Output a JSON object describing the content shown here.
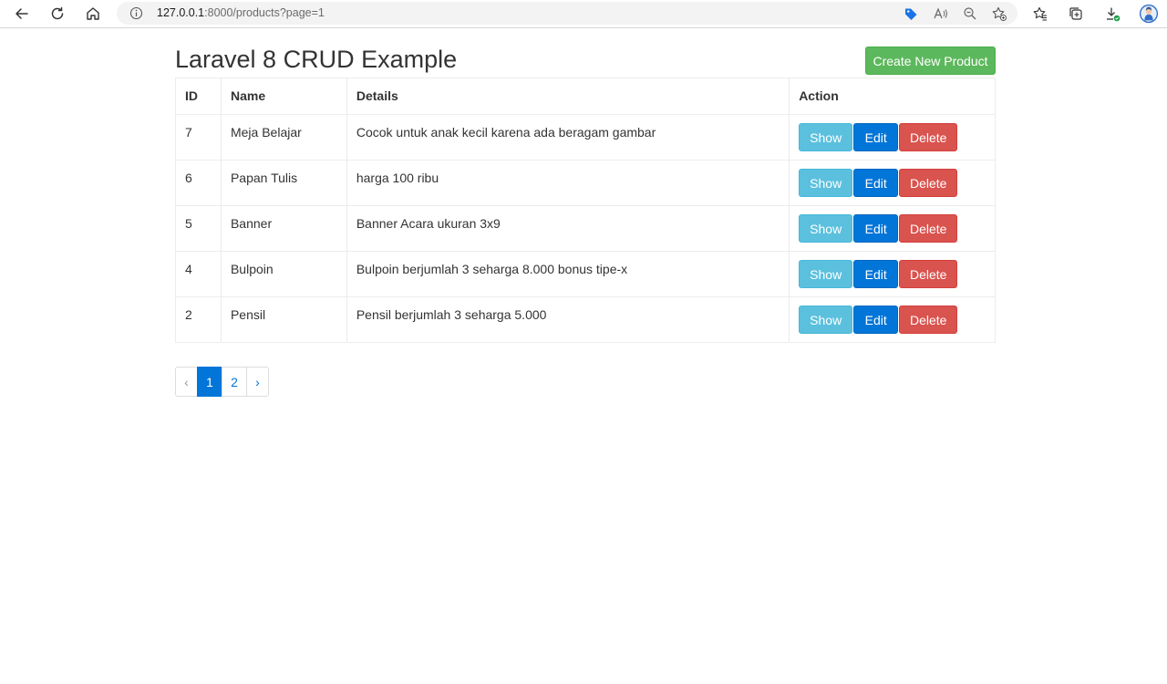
{
  "browser": {
    "url_host": "127.0.0.1",
    "url_rest": ":8000/products?page=1"
  },
  "page": {
    "title": "Laravel 8 CRUD Example",
    "create_button": "Create New Product"
  },
  "table": {
    "headers": [
      "ID",
      "Name",
      "Details",
      "Action"
    ],
    "rows": [
      {
        "id": "7",
        "name": "Meja Belajar",
        "details": "Cocok untuk anak kecil karena ada beragam gambar"
      },
      {
        "id": "6",
        "name": "Papan Tulis",
        "details": "harga 100 ribu"
      },
      {
        "id": "5",
        "name": "Banner",
        "details": "Banner Acara ukuran 3x9"
      },
      {
        "id": "4",
        "name": "Bulpoin",
        "details": "Bulpoin berjumlah 3 seharga 8.000 bonus tipe-x"
      },
      {
        "id": "2",
        "name": "Pensil",
        "details": "Pensil berjumlah 3 seharga 5.000"
      }
    ],
    "actions": {
      "show": "Show",
      "edit": "Edit",
      "delete": "Delete"
    }
  },
  "pagination": {
    "prev": "‹",
    "pages": [
      "1",
      "2"
    ],
    "next": "›",
    "active_page": "1"
  },
  "colors": {
    "success": "#5cb85c",
    "info": "#5bc0de",
    "primary": "#0275d8",
    "danger": "#d9534f"
  },
  "icons": [
    "back-arrow-icon",
    "refresh-icon",
    "home-icon",
    "info-icon",
    "tag-icon",
    "read-aloud-icon",
    "zoom-out-icon",
    "add-favorite-icon",
    "favorites-icon",
    "collections-icon",
    "downloads-icon",
    "profile-avatar"
  ]
}
